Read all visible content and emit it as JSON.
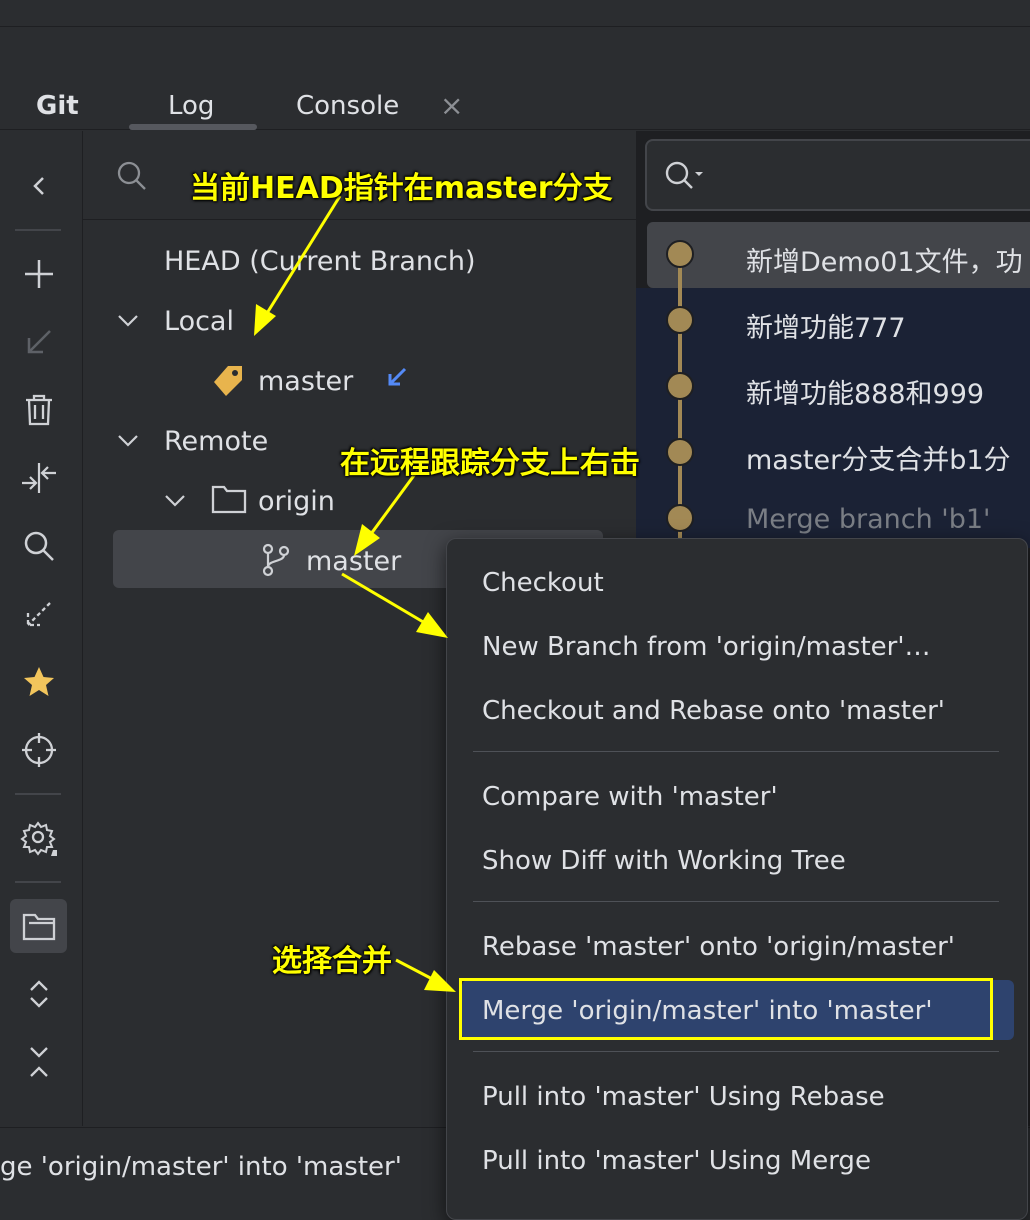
{
  "tabs": {
    "git_label": "Git",
    "log_label": "Log",
    "console_label": "Console",
    "close_glyph": "×"
  },
  "branches": {
    "head_label": "HEAD (Current Branch)",
    "local_label": "Local",
    "local_branch": "master",
    "remote_label": "Remote",
    "remote_name": "origin",
    "remote_branch": "master"
  },
  "commits": [
    {
      "message": "新增Demo01文件，功"
    },
    {
      "message": "新增功能777"
    },
    {
      "message": "新增功能888和999"
    },
    {
      "message": "master分支合并b1分"
    },
    {
      "message": "Merge branch 'b1'"
    }
  ],
  "context_menu": {
    "items": [
      "Checkout",
      "New Branch from 'origin/master'…",
      "Checkout and Rebase onto 'master'",
      "Compare with 'master'",
      "Show Diff with Working Tree",
      "Rebase 'master' onto 'origin/master'",
      "Merge 'origin/master' into 'master'",
      "Pull into 'master' Using Rebase",
      "Pull into 'master' Using Merge"
    ]
  },
  "status": {
    "text": "ge 'origin/master' into 'master'"
  },
  "annotations": {
    "head_note": "当前HEAD指针在master分支",
    "remote_note": "在远程跟踪分支上右击",
    "merge_note": "选择合并"
  },
  "colors": {
    "background": "#2b2d30",
    "log_background": "#1e1f22",
    "graph": "#a28955",
    "selection": "#2e436e",
    "annotation": "#ffff00",
    "tag_icon": "#e8b44d",
    "incoming_arrow": "#548af7"
  },
  "icons": {
    "toolbar": [
      "collapse-left-icon",
      "add-icon",
      "checkout-arrow-icon",
      "delete-icon",
      "merge-arrows-icon",
      "search-icon",
      "update-icon",
      "favorite-star-icon",
      "locate-icon",
      "settings-icon",
      "group-by-directory-icon",
      "expand-icon",
      "collapse-icon"
    ]
  }
}
